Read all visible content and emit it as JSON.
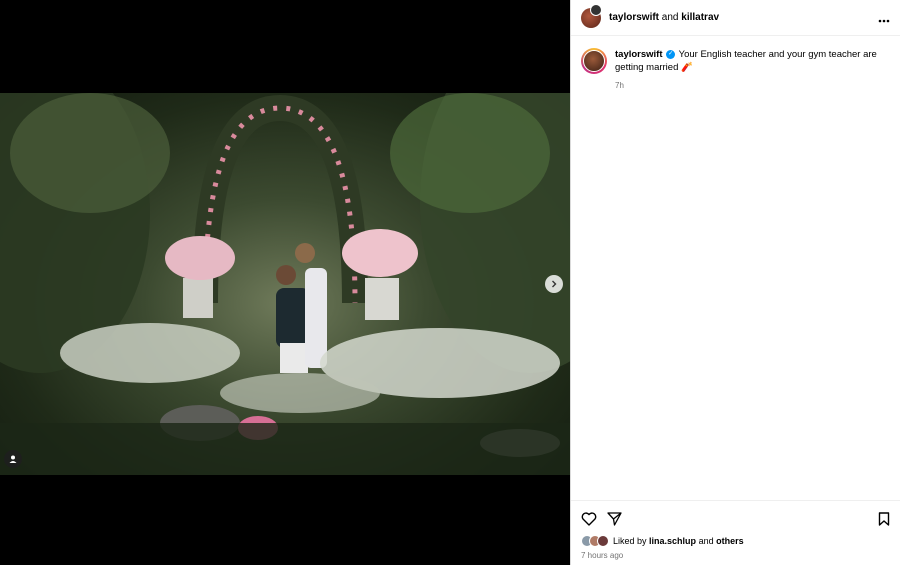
{
  "header": {
    "username": "taylorswift",
    "joiner": "and",
    "collaborator": "killatrav",
    "more_icon": "more-horizontal-icon"
  },
  "caption": {
    "username": "taylorswift",
    "verified_icon": "verified-badge-icon",
    "text": "Your English teacher and your gym teacher are getting married",
    "emoji": "🧨",
    "time": "7h"
  },
  "media": {
    "next_icon": "chevron-right-icon",
    "tag_icon": "user-tag-icon",
    "carousel_count": 2,
    "carousel_active": 1
  },
  "actions": {
    "like_icon": "heart-icon",
    "share_icon": "send-icon",
    "save_icon": "bookmark-icon"
  },
  "likes": {
    "prefix": "Liked by",
    "user": "lina.schlup",
    "joiner": "and",
    "others": "others"
  },
  "post_time": "7 hours ago",
  "colors": {
    "verified": "#0095f6",
    "secondary_text": "#737373",
    "border": "#dbdbdb"
  }
}
